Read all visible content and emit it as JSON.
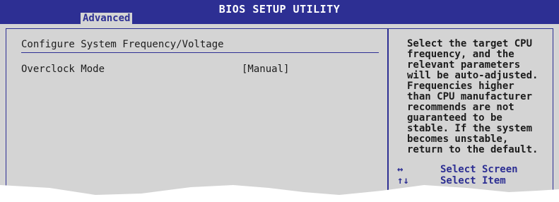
{
  "header": {
    "title": "BIOS SETUP UTILITY",
    "active_tab": "Advanced"
  },
  "main": {
    "section_title": "Configure System Frequency/Voltage",
    "items": [
      {
        "label": "Overclock Mode",
        "value": "[Manual]"
      }
    ]
  },
  "help": {
    "lines": [
      "Select the target CPU",
      "frequency, and the",
      "relevant parameters",
      "will be auto-adjusted.",
      "Frequencies higher",
      "than CPU manufacturer",
      "recommends are not",
      "guaranteed to be",
      "stable. If the system",
      "becomes unstable,",
      "return to the default."
    ]
  },
  "keys": [
    {
      "symbol": "↔",
      "label": "Select Screen"
    },
    {
      "symbol": "↑↓",
      "label": "Select Item"
    }
  ],
  "colors": {
    "accent": "#2d2f93",
    "panel": "#d4d4d4",
    "text": "#1c1c1c"
  }
}
